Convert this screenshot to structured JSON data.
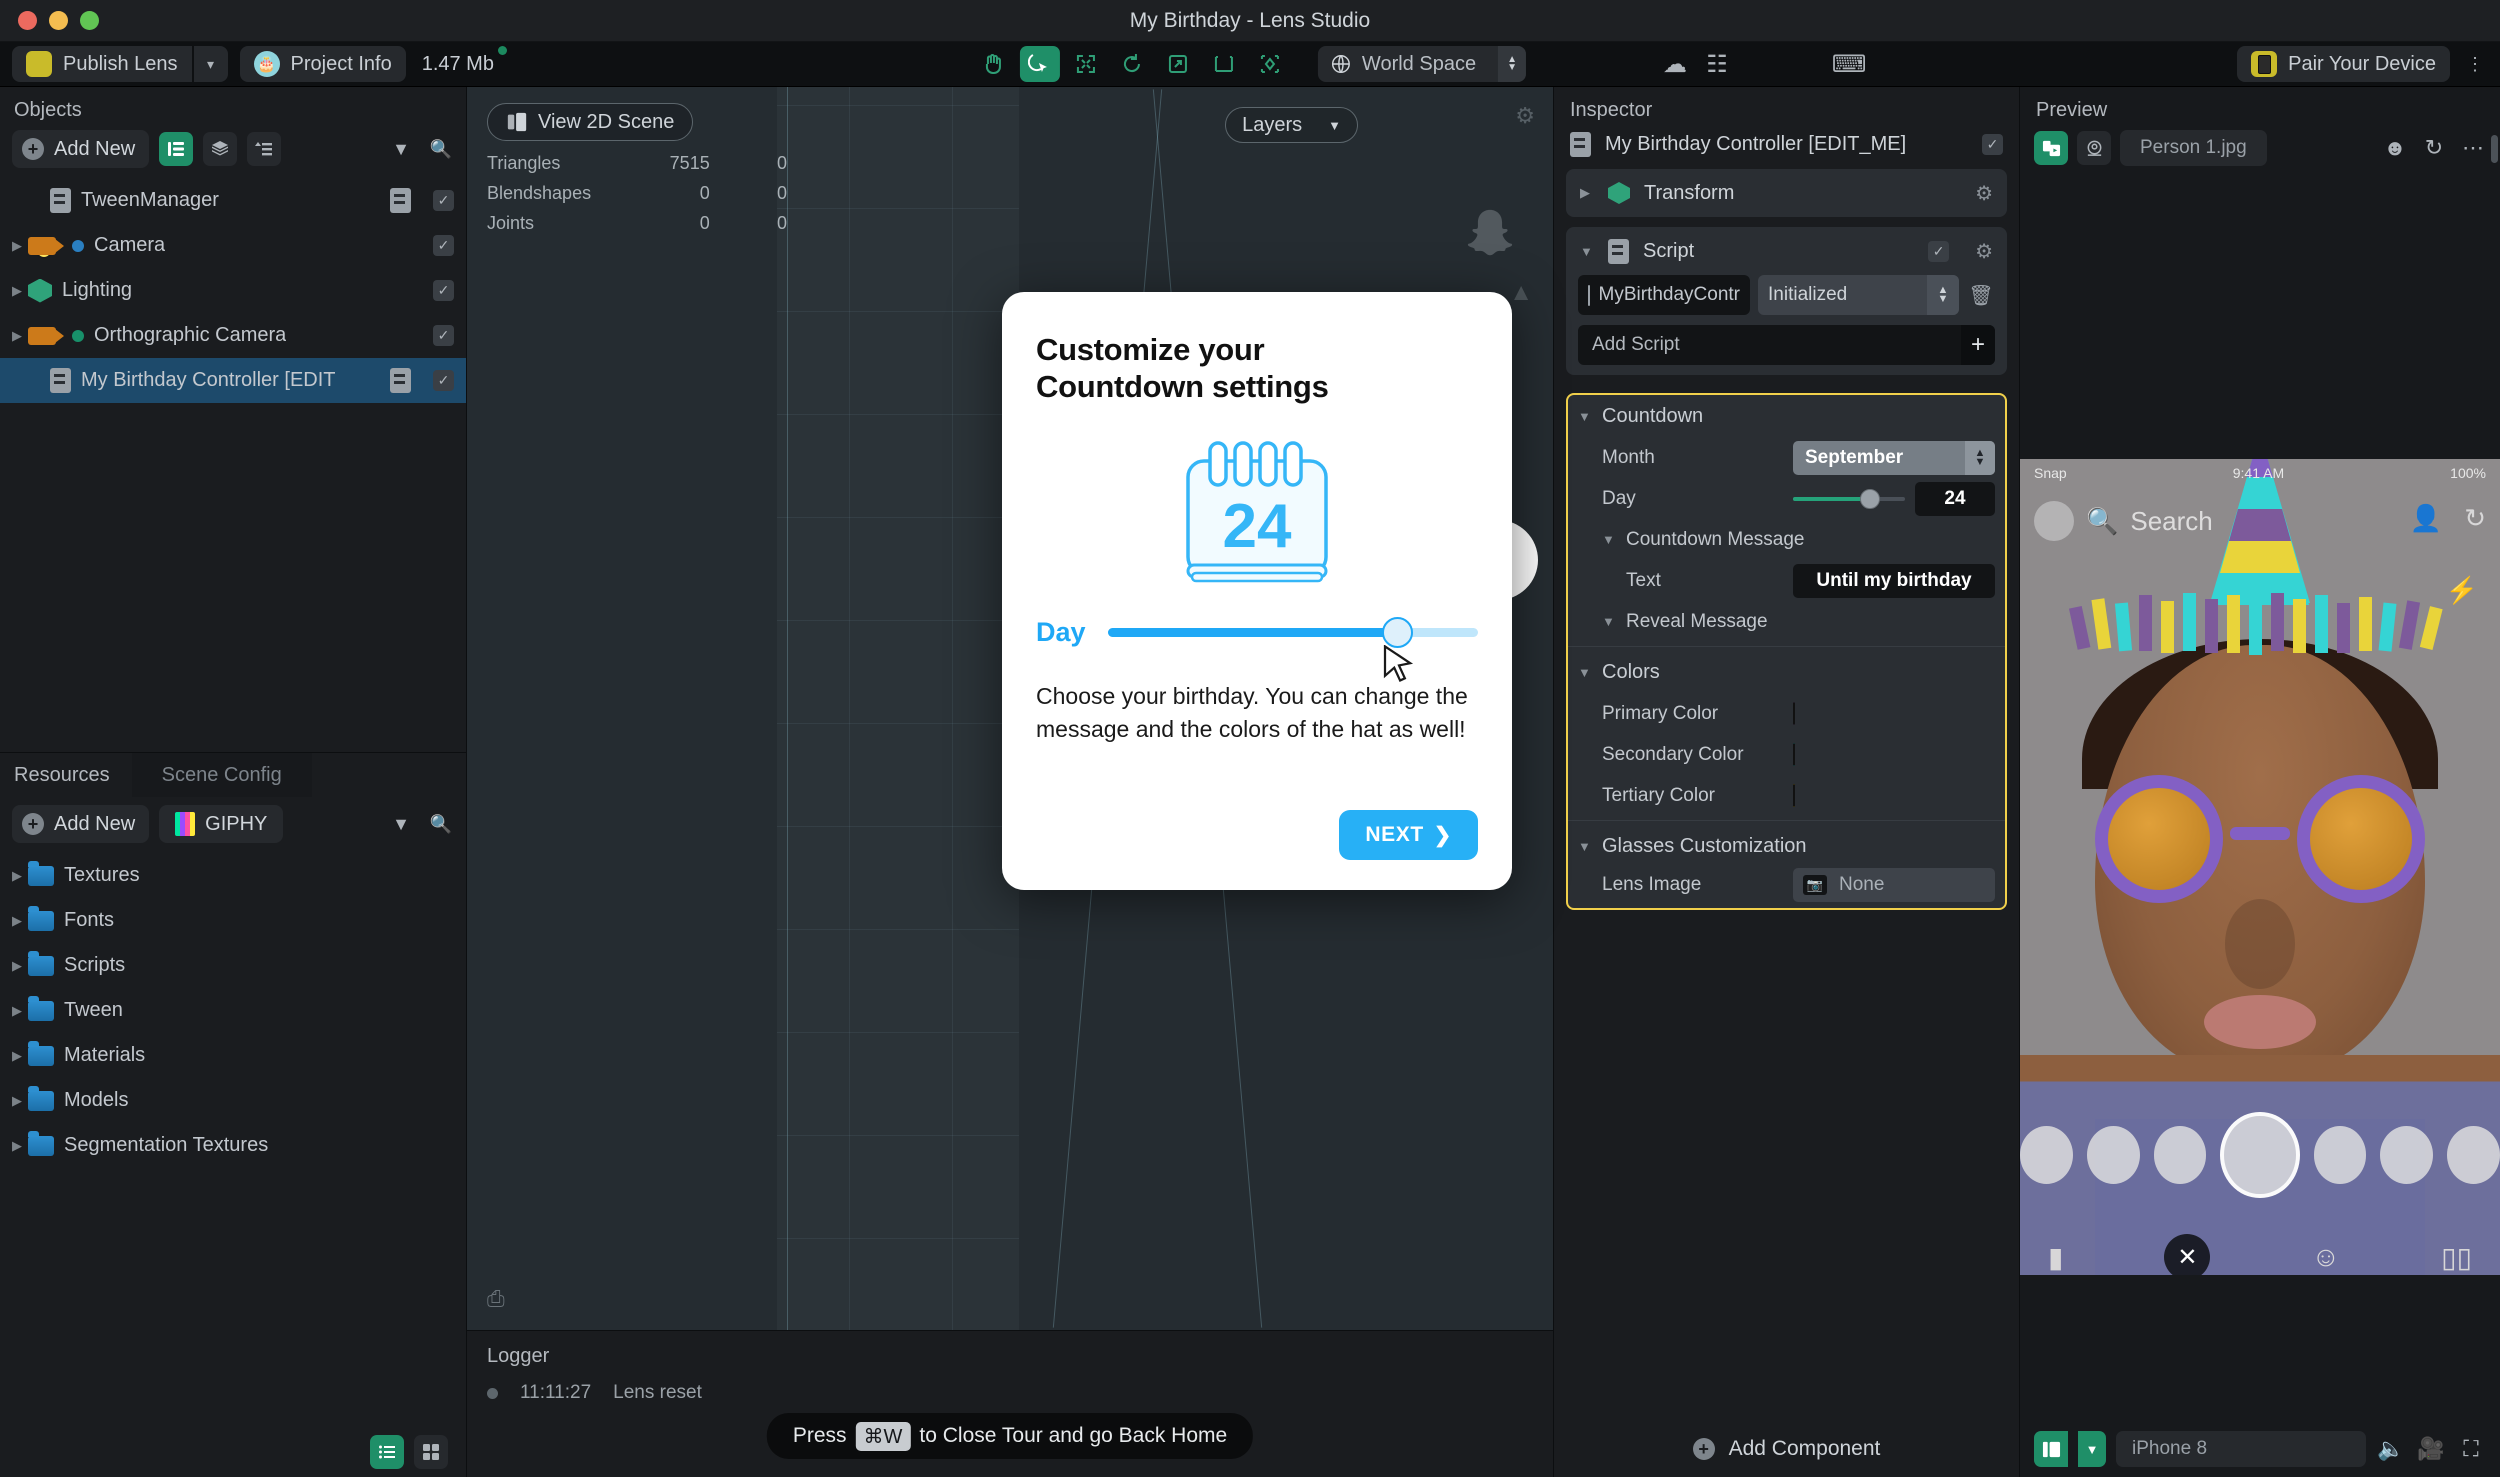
{
  "window": {
    "title": "My Birthday - Lens Studio"
  },
  "toolbar": {
    "publish_label": "Publish Lens",
    "project_info_label": "Project Info",
    "file_size": "1.47 Mb",
    "tools": [
      {
        "name": "hand-tool",
        "label": "Hand",
        "active": false
      },
      {
        "name": "select-tool",
        "label": "Select",
        "active": true
      },
      {
        "name": "move-tool",
        "label": "Move",
        "active": false
      },
      {
        "name": "rotate-tool",
        "label": "Rotate",
        "active": false
      },
      {
        "name": "scale-tool",
        "label": "Scale",
        "active": false
      },
      {
        "name": "rect-tool",
        "label": "Rect",
        "active": false
      },
      {
        "name": "pivot-tool",
        "label": "Pivot",
        "active": false
      }
    ],
    "space_selector": "World Space",
    "pair_device_label": "Pair Your Device"
  },
  "objects_panel": {
    "title": "Objects",
    "add_new_label": "Add New",
    "items": [
      {
        "label": "TweenManager",
        "icon": "script-icon",
        "indent": 1,
        "expandable": false,
        "selected": false,
        "checked": true,
        "has_script": true
      },
      {
        "label": "Camera",
        "icon": "camera-icon",
        "indent": 0,
        "expandable": true,
        "selected": false,
        "checked": true,
        "dot": "blue"
      },
      {
        "label": "Lighting",
        "icon": "cube-icon",
        "indent": 0,
        "expandable": true,
        "selected": false,
        "checked": true
      },
      {
        "label": "Orthographic Camera",
        "icon": "camera-icon",
        "indent": 0,
        "expandable": true,
        "selected": false,
        "checked": true,
        "dot": "green"
      },
      {
        "label": "My Birthday Controller [EDIT",
        "icon": "script-icon",
        "indent": 1,
        "expandable": false,
        "selected": true,
        "checked": true,
        "has_script": true
      }
    ]
  },
  "resources_panel": {
    "tab_active": "Resources",
    "tab_inactive": "Scene Config",
    "add_new_label": "Add New",
    "giphy_label": "GIPHY",
    "folders": [
      "Textures",
      "Fonts",
      "Scripts",
      "Tween",
      "Materials",
      "Models",
      "Segmentation Textures"
    ]
  },
  "viewport": {
    "view_2d_label": "View 2D Scene",
    "layers_label": "Layers",
    "stats": [
      {
        "label": "Triangles",
        "value": "7515",
        "value2": "0"
      },
      {
        "label": "Blendshapes",
        "value": "0",
        "value2": "0"
      },
      {
        "label": "Joints",
        "value": "0",
        "value2": "0"
      }
    ]
  },
  "logger": {
    "title": "Logger",
    "entries": [
      {
        "time": "11:11:27",
        "message": "Lens reset"
      }
    ],
    "hint_prefix": "Press",
    "hint_key": "⌘W",
    "hint_suffix": "to Close Tour and go Back Home"
  },
  "inspector": {
    "title": "Inspector",
    "object_name": "My Birthday Controller [EDIT_ME]",
    "transform_label": "Transform",
    "script_label": "Script",
    "script_name": "MyBirthdayContr",
    "script_state": "Initialized",
    "add_script_label": "Add Script",
    "add_component_label": "Add Component",
    "groups": {
      "countdown_label": "Countdown",
      "month_label": "Month",
      "month_value": "September",
      "day_label": "Day",
      "day_value": "24",
      "countdown_message_label": "Countdown Message",
      "text_label": "Text",
      "text_value": "Until my birthday",
      "reveal_message_label": "Reveal Message",
      "colors_label": "Colors",
      "primary_color_label": "Primary Color",
      "primary_color": "#7d5a9b",
      "secondary_color_label": "Secondary Color",
      "secondary_color": "#25efef",
      "tertiary_color_label": "Tertiary Color",
      "tertiary_color": "#ffcd17",
      "glasses_label": "Glasses Customization",
      "lens_image_label": "Lens Image",
      "lens_image_value": "None"
    }
  },
  "preview": {
    "title": "Preview",
    "file_name": "Person 1.jpg",
    "device": "iPhone 8",
    "phone": {
      "carrier": "Snap",
      "time": "9:41 AM",
      "battery": "100%",
      "search_placeholder": "Search"
    }
  },
  "modal": {
    "title_line1": "Customize your",
    "title_line2": "Countdown settings",
    "calendar_day": "24",
    "day_label": "Day",
    "body": "Choose your birthday. You can change the message and the colors of the hat as well!",
    "next_label": "NEXT",
    "accent": "#27b0f6"
  }
}
